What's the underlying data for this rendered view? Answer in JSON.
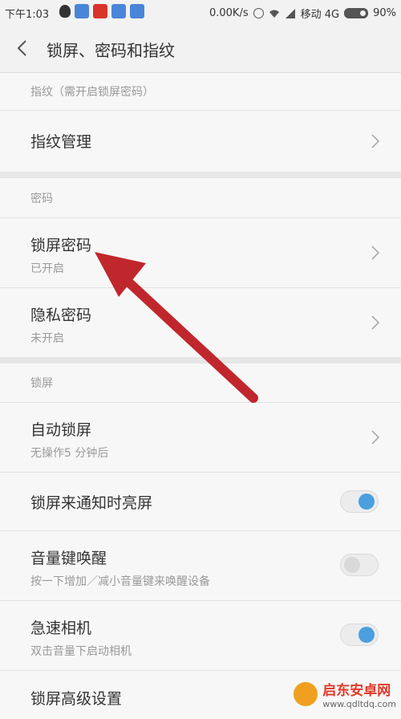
{
  "status_bar": {
    "time": "下午1:03",
    "speed": "0.00K/s",
    "carrier": "移动 4G",
    "battery": "90%",
    "icons": [
      "qq-icon",
      "app-blue-icon",
      "app-red-icon",
      "app-blue-icon",
      "app-blue-icon",
      "alarm-icon",
      "wifi-icon",
      "signal-icon",
      "battery-icon"
    ]
  },
  "header": {
    "title": "锁屏、密码和指纹",
    "back_icon": "chevron-left-icon"
  },
  "sections": {
    "fingerprint_header": "指纹（需开启锁屏密码）",
    "password_header": "密码",
    "lockscreen_header": "锁屏"
  },
  "items": {
    "fingerprint_manage": {
      "title": "指纹管理"
    },
    "lock_password": {
      "title": "锁屏密码",
      "sub": "已开启"
    },
    "privacy_password": {
      "title": "隐私密码",
      "sub": "未开启"
    },
    "auto_lock": {
      "title": "自动锁屏",
      "sub": "无操作5 分钟后"
    },
    "notify_wake": {
      "title": "锁屏来通知时亮屏",
      "on": true
    },
    "volume_wake": {
      "title": "音量键唤醒",
      "sub": "按一下增加／减小音量键来唤醒设备",
      "on": false
    },
    "quick_camera": {
      "title": "急速相机",
      "sub": "双击音量下启动相机",
      "on": true
    },
    "advanced": {
      "title": "锁屏高级设置"
    }
  },
  "colors": {
    "toggle_on": "#4a9fde",
    "annotation_arrow": "#c0272d"
  },
  "watermark": {
    "name": "启东安卓网",
    "url": "www.qdltdq.com"
  }
}
